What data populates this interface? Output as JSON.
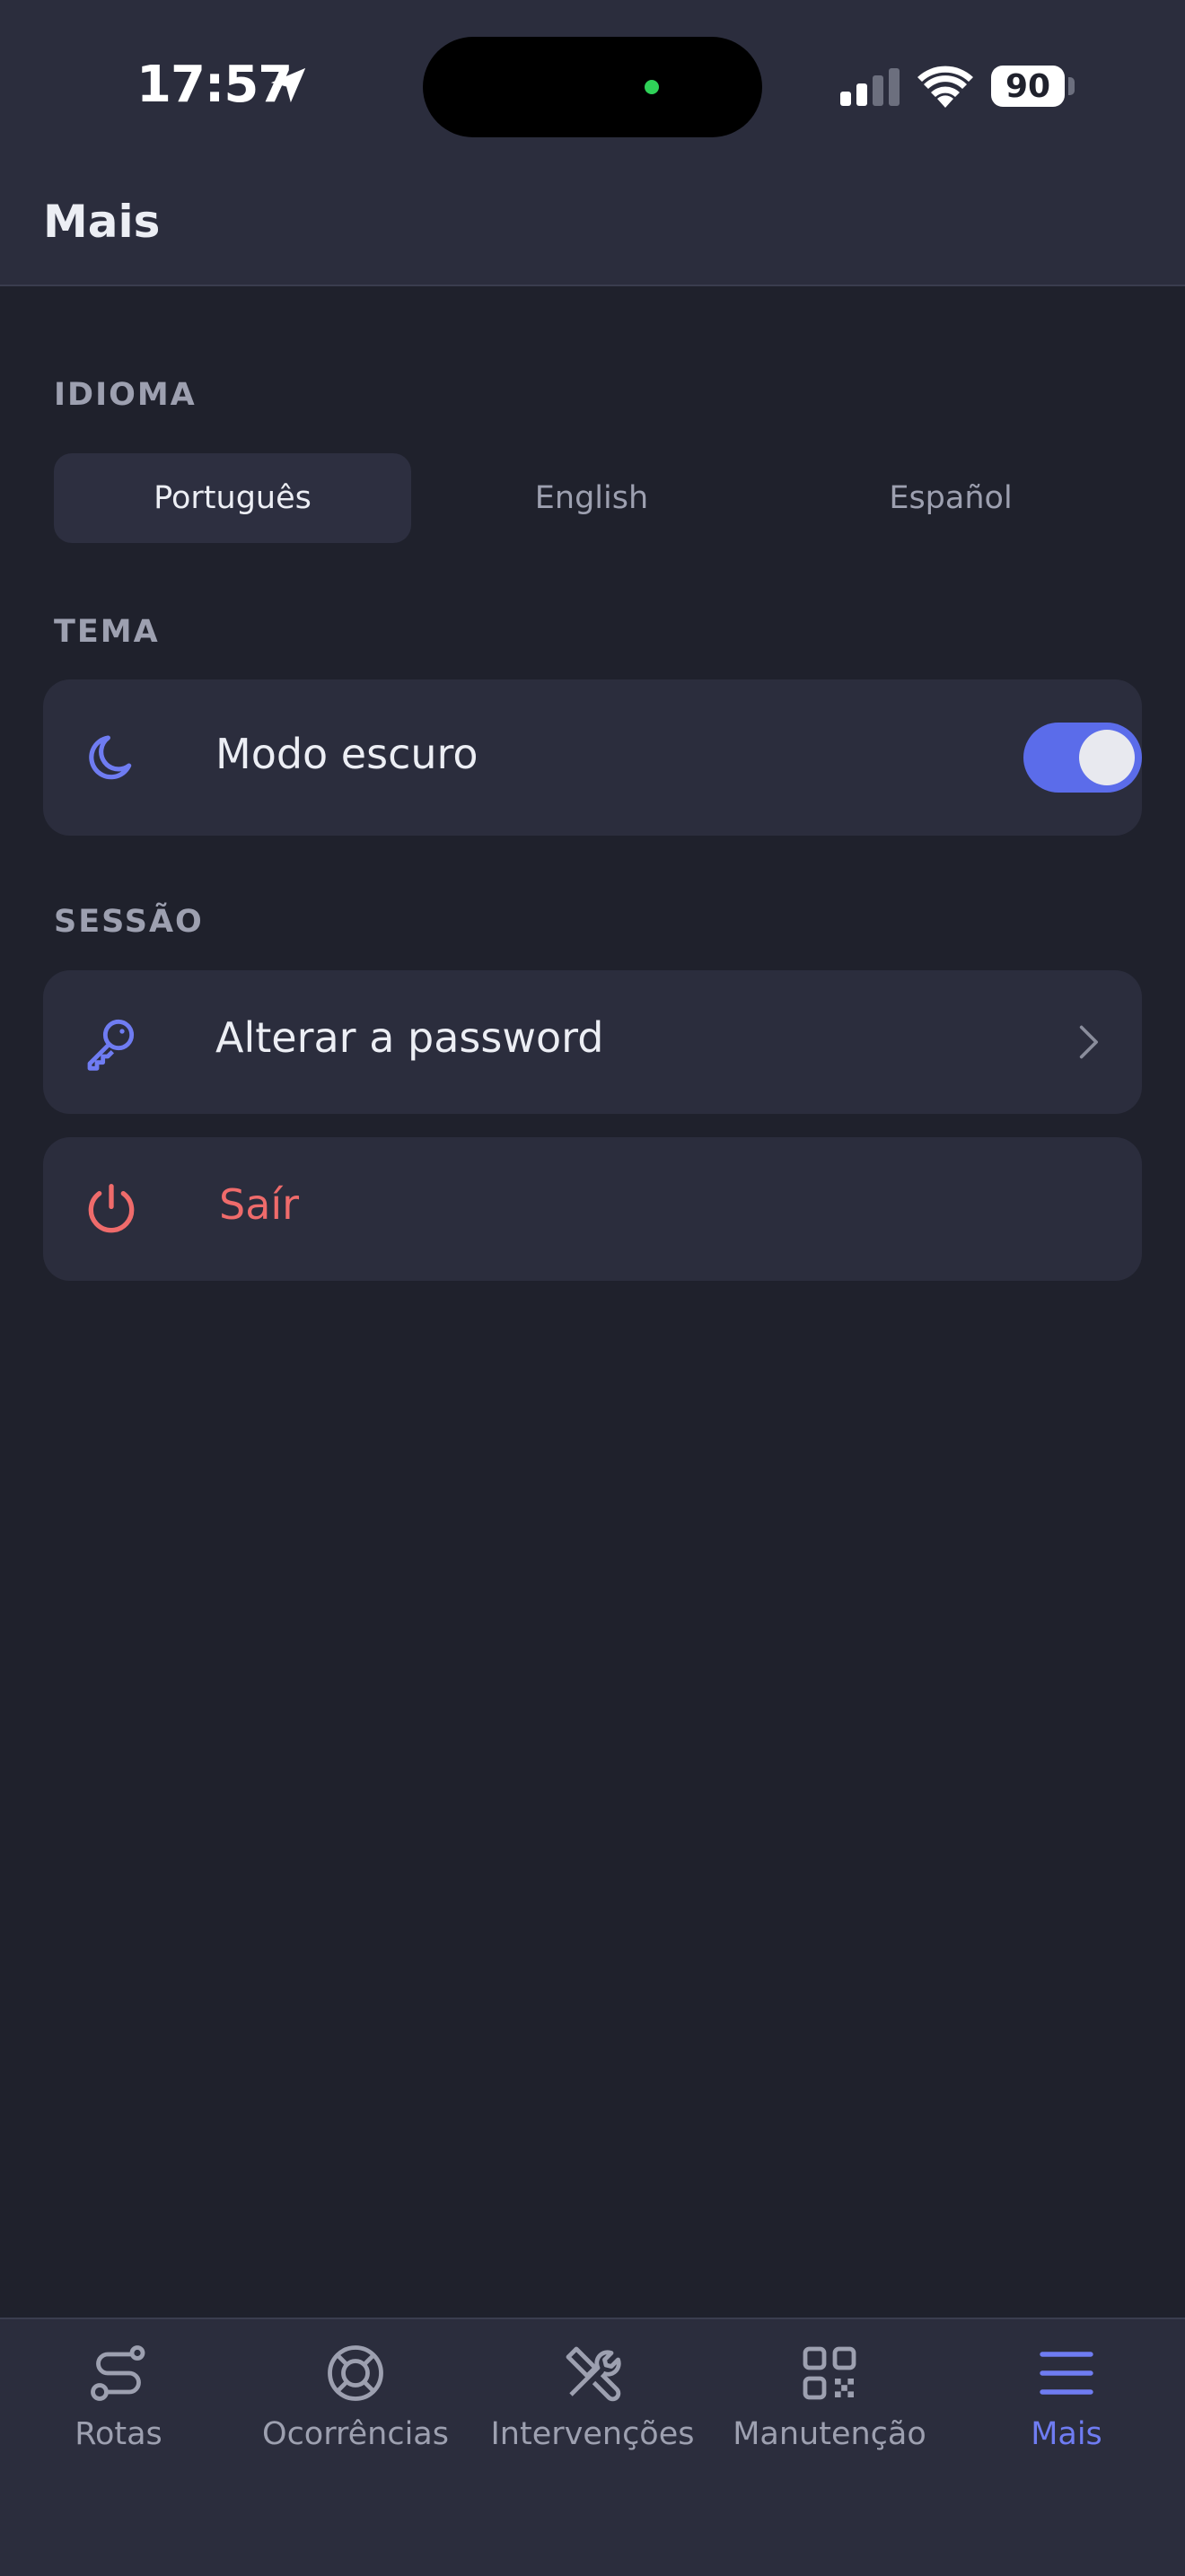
{
  "status_bar": {
    "time": "17:57",
    "battery": "90"
  },
  "header": {
    "title": "Mais"
  },
  "language": {
    "section_label": "IDIOMA",
    "options": [
      "Português",
      "English",
      "Español"
    ],
    "selected": "Português"
  },
  "theme": {
    "section_label": "TEMA",
    "dark_mode_label": "Modo escuro",
    "dark_mode_on": true
  },
  "session": {
    "section_label": "SESSÃO",
    "change_password_label": "Alterar a password",
    "logout_label": "Saír"
  },
  "tabs": [
    {
      "label": "Rotas",
      "icon": "route-icon"
    },
    {
      "label": "Ocorrências",
      "icon": "lifebuoy-icon"
    },
    {
      "label": "Intervenções",
      "icon": "tools-icon"
    },
    {
      "label": "Manutenção",
      "icon": "qr-code-icon"
    },
    {
      "label": "Mais",
      "icon": "menu-icon"
    }
  ],
  "active_tab": "Mais",
  "colors": {
    "background": "#1f212c",
    "surface": "#2b2d3d",
    "accent": "#5b6cea",
    "danger": "#ef6b6b",
    "muted_text": "#9da0b0"
  }
}
